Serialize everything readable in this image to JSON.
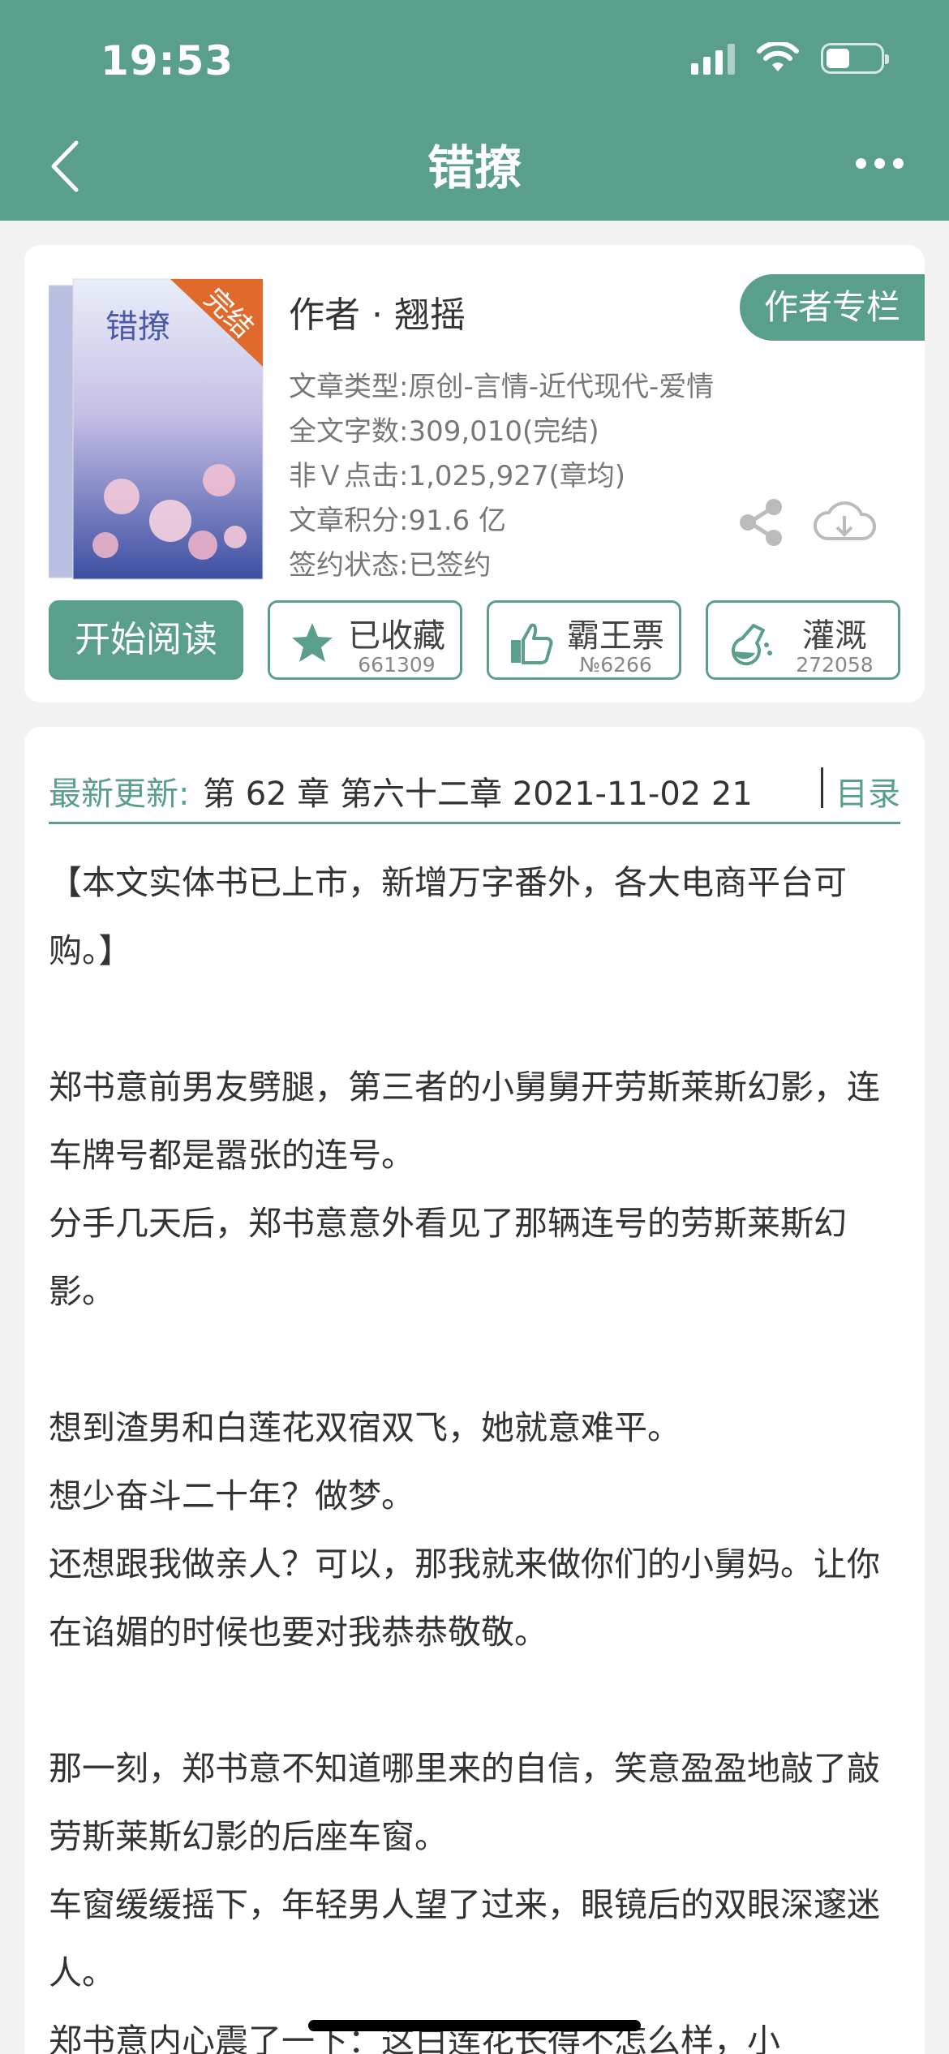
{
  "status": {
    "time": "19:53"
  },
  "nav": {
    "title": "错撩"
  },
  "book": {
    "cover_badge": "完结",
    "cover_title": "错撩",
    "author": "作者 · 翘摇",
    "author_column": "作者专栏",
    "meta": [
      "文章类型:原创-言情-近代现代-爱情",
      "全文字数:309,010(完结)",
      "非Ｖ点击:1,025,927(章均)",
      "文章积分:91.6 亿",
      "签约状态:已签约"
    ]
  },
  "actions": {
    "read_label": "开始阅读",
    "favorite_label": "已收藏",
    "favorite_count": "661309",
    "ticket_label": "霸王票",
    "ticket_rank": "№6266",
    "water_label": "灌溉",
    "water_count": "272058"
  },
  "latest": {
    "label": "最新更新:",
    "text": "第 62 章 第六十二章 2021-11-02 21:",
    "toc": "目录"
  },
  "synopsis": [
    "【本文实体书已上市，新增万字番外，各大电商平台可购。】",
    "",
    "郑书意前男友劈腿，第三者的小舅舅开劳斯莱斯幻影，连车牌号都是嚣张的连号。",
    "分手几天后，郑书意意外看见了那辆连号的劳斯莱斯幻影。",
    "",
    "想到渣男和白莲花双宿双飞，她就意难平。",
    "想少奋斗二十年？做梦。",
    "还想跟我做亲人？可以，那我就来做你们的小舅妈。让你在谄媚的时候也要对我恭恭敬敬。",
    "",
    "那一刻，郑书意不知道哪里来的自信，笑意盈盈地敲了敲劳斯莱斯幻影的后座车窗。",
    "车窗缓缓摇下，年轻男人望了过来，眼镜后的双眼深邃迷人。",
    "郑书意内心震了一下：这白莲花长得不怎么样，小"
  ],
  "colors": {
    "accent": "#5a9e8c"
  }
}
